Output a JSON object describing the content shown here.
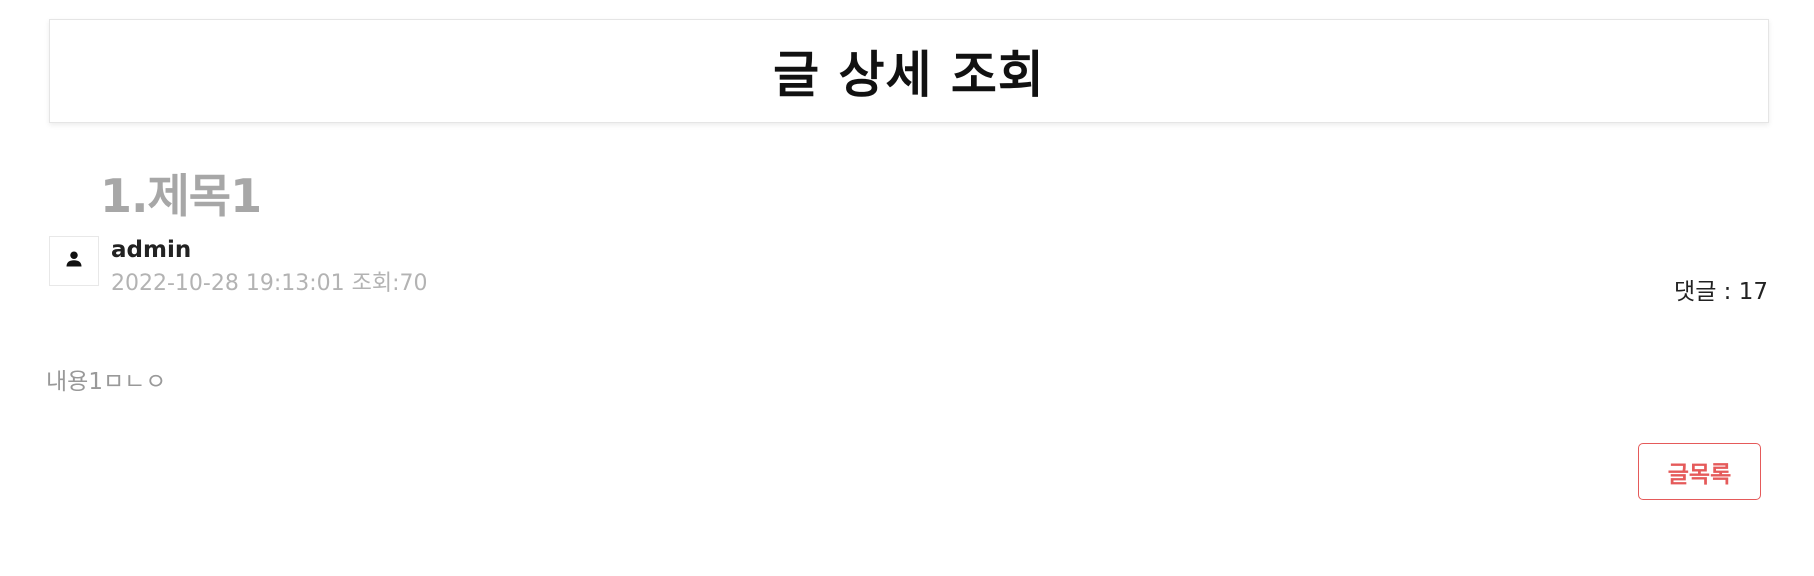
{
  "header": {
    "title": "글 상세 조회"
  },
  "post": {
    "title": "1.제목1",
    "author": "admin",
    "meta": "2022-10-28 19:13:01 조회:70",
    "comment_count": "댓글 : 17",
    "content": "내용1ㅁㄴㅇ"
  },
  "icons": {
    "avatar": "user-icon"
  },
  "actions": {
    "list_label": "글목록"
  },
  "colors": {
    "accent": "#e55a5a",
    "title_gray": "#a7a7a7",
    "meta_gray": "#b3b3b3"
  }
}
